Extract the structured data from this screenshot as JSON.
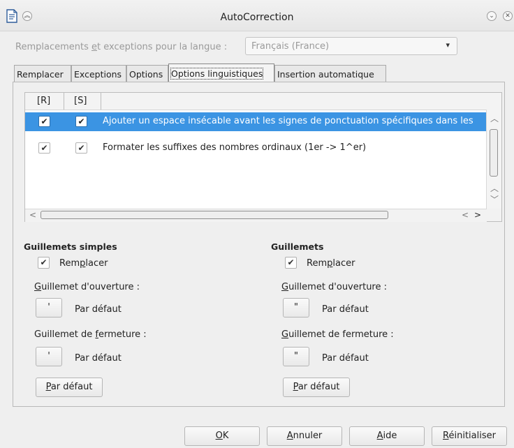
{
  "window": {
    "title": "AutoCorrection"
  },
  "language": {
    "label": "Remplacements et exceptions pour la langue :",
    "value": "Français (France)"
  },
  "tabs": [
    {
      "label": "Remplacer"
    },
    {
      "label": "Exceptions"
    },
    {
      "label": "Options"
    },
    {
      "label": "Options linguistiques",
      "active": true
    },
    {
      "label": "Insertion automatique"
    }
  ],
  "options_list": {
    "col_r": "[R]",
    "col_s": "[S]",
    "rows": [
      {
        "text": "Ajouter un espace insécable avant les signes de ponctuation spécifiques dans les",
        "r": true,
        "s": true,
        "selected": true
      },
      {
        "text": "Formater les suffixes des nombres ordinaux (1er -> 1^er)",
        "r": true,
        "s": true,
        "selected": false
      }
    ]
  },
  "single_quotes": {
    "title": "Guillemets simples",
    "replace_label": "Remplacer",
    "replace_checked": true,
    "opening_label": "Guillemet d'ouverture :",
    "opening_char": "'",
    "opening_default": "Par défaut",
    "closing_label": "Guillemet de fermeture :",
    "closing_char": "'",
    "closing_default": "Par défaut",
    "default_button": "Par défaut"
  },
  "double_quotes": {
    "title": "Guillemets",
    "replace_label": "Remplacer",
    "replace_checked": true,
    "opening_label": "Guillemet d'ouverture :",
    "opening_char": "\"",
    "opening_default": "Par défaut",
    "closing_label": "Guillemet de fermeture :",
    "closing_char": "\"",
    "closing_default": "Par défaut",
    "default_button": "Par défaut"
  },
  "footer": {
    "ok": "OK",
    "cancel": "Annuler",
    "help": "Aide",
    "reset": "Réinitialiser"
  },
  "icons": {
    "check": "✔",
    "chevron_down": "⌄"
  }
}
